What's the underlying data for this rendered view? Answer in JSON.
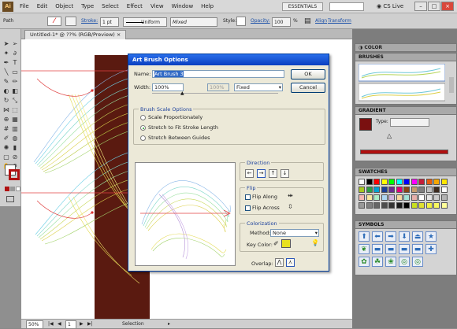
{
  "menubar": {
    "logo": "Ai",
    "items": [
      "File",
      "Edit",
      "Object",
      "Type",
      "Select",
      "Effect",
      "View",
      "Window",
      "Help"
    ],
    "workspace": "ESSENTIALS",
    "cs_live": "CS Live"
  },
  "control": {
    "path_label": "Path",
    "stroke_label": "Stroke:",
    "stroke_value": "1 pt",
    "profile": "Uniform",
    "brush": "Mixed",
    "style_label": "Style:",
    "opacity_label": "Opacity:",
    "opacity_value": "100",
    "opacity_unit": "%",
    "align": "Align",
    "transform": "Transform"
  },
  "document_tab": "Untitled-1* @ ??% (RGB/Preview)",
  "status": {
    "zoom": "50%",
    "page": "1",
    "tool": "Selection"
  },
  "panels": {
    "color": "COLOR",
    "brushes": "BRUSHES",
    "gradient": "GRADIENT",
    "type_label": "Type:",
    "swatches": "SWATCHES",
    "symbols": "SYMBOLS"
  },
  "dialog": {
    "title": "Art Brush Options",
    "name_label": "Name:",
    "name_value": "Art Brush 3",
    "width_label": "Width:",
    "width_value": "100%",
    "width_secondary": "100%",
    "width_mode": "Fixed",
    "ok": "OK",
    "cancel": "Cancel",
    "scale_group": "Brush Scale Options",
    "scale_options": [
      "Scale Proportionately",
      "Stretch to Fit Stroke Length",
      "Stretch Between Guides"
    ],
    "scale_selected": 1,
    "direction_group": "Direction",
    "flip_group": "Flip",
    "flip_along": "Flip Along",
    "flip_across": "Flip Across",
    "colorization_group": "Colorization",
    "method_label": "Method:",
    "method_value": "None",
    "key_color_label": "Key Color:",
    "key_color": "#e8e01c",
    "overlap_label": "Overlap:"
  },
  "swatch_colors": [
    "#ffffff",
    "#000000",
    "#ff0000",
    "#ffff00",
    "#00ff00",
    "#00ffff",
    "#0000ff",
    "#ff00ff",
    "#c41e3a",
    "#e95d0f",
    "#f7a700",
    "#ffe600",
    "#a8c81f",
    "#2f9e44",
    "#00a2d3",
    "#1b3f94",
    "#6b2c91",
    "#e0007a",
    "#8b4513",
    "#c69c6d",
    "#7f7f7f",
    "#bfbfbf",
    "#3c2a1e",
    "#ffffff",
    "#f5b7b1",
    "#f9e79f",
    "#abebc6",
    "#aed6f1",
    "#d2b4de",
    "#fad7a0",
    "#a3e4d7",
    "#e6b0aa",
    "#ffffff",
    "#e6e6e6",
    "#cccccc",
    "#b3b3b3",
    "#999999",
    "#808080",
    "#666666",
    "#4d4d4d",
    "#333333",
    "#1a1a1a",
    "#000000",
    "#c8e020",
    "#e0e030",
    "#f0f040",
    "#f8f860",
    "#ffff99"
  ]
}
